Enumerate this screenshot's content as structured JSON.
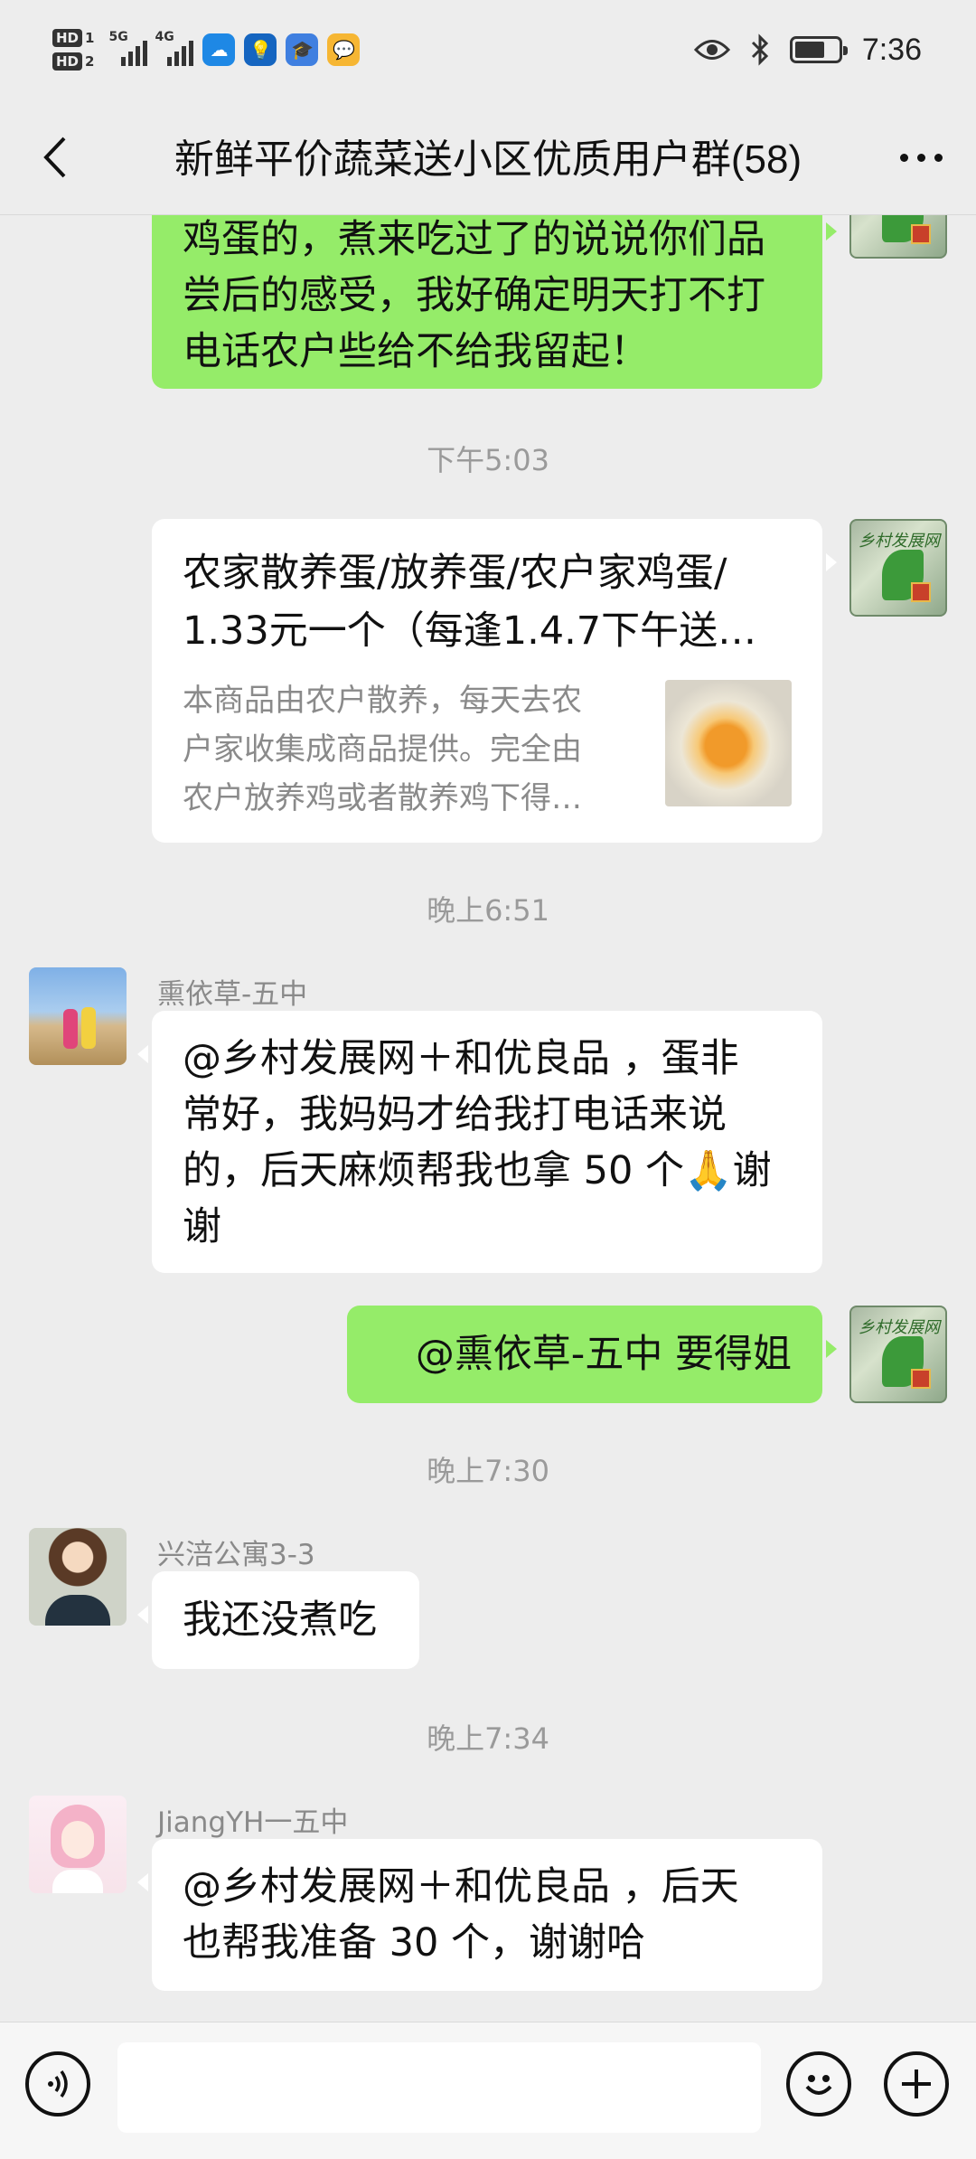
{
  "status_bar": {
    "hd1": "HD",
    "hd1_num": "1",
    "hd2": "HD",
    "hd2_num": "2",
    "net1": "5G",
    "net2": "4G",
    "time": "7:36",
    "icons": [
      "signal-icon",
      "weather-app-icon",
      "bulb-app-icon",
      "cap-app-icon",
      "chat-app-icon",
      "eye-icon",
      "bluetooth-icon",
      "battery-icon"
    ]
  },
  "header": {
    "title": "新鲜平价蔬菜送小区优质用户群(58)"
  },
  "messages": {
    "m1": {
      "line1": "鸡蛋的，煮来吃过了的说说你们品",
      "line2": "尝后的感受，我好确定明天打不打",
      "line3": "电话农户些给不给我留起！"
    },
    "ts1": "下午5:03",
    "card": {
      "title_line1": "农家散养蛋/放养蛋/农户家鸡蛋/",
      "title_line2": "1.33元一个（每逢1.4.7下午送…",
      "desc_line1": "本商品由农户散养，每天去农",
      "desc_line2": "户家收集成商品提供。完全由",
      "desc_line3": "农户放养鸡或者散养鸡下得…"
    },
    "ts2": "晚上6:51",
    "m2": {
      "sender": "熏依草-五中",
      "line1": "@乡村发展网＋和优良品 ，蛋非",
      "line2": "常好，我妈妈才给我打电话来说",
      "line3": "的，后天麻烦帮我也拿 50 个🙏谢",
      "line4": "谢"
    },
    "m3": {
      "text": "@熏依草-五中  要得姐"
    },
    "ts3": "晚上7:30",
    "m4": {
      "sender": "兴涪公寓3-3",
      "text": "我还没煮吃"
    },
    "ts4": "晚上7:34",
    "m5": {
      "sender": "JiangYH一五中",
      "line1": "@乡村发展网＋和优良品 ，后天",
      "line2": "也帮我准备 30 个，谢谢哈"
    }
  },
  "input_bar": {
    "placeholder": "",
    "value": ""
  }
}
